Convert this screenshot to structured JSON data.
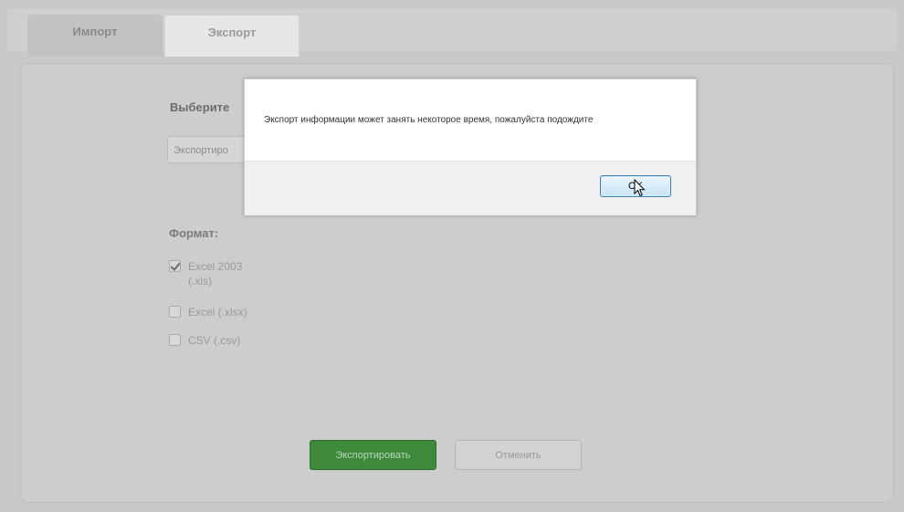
{
  "tabs": [
    {
      "label": "Импорт",
      "active": false
    },
    {
      "label": "Экспорт",
      "active": true
    }
  ],
  "form": {
    "select_label": "Выберите",
    "select_value": "Экспортиро",
    "format_label": "Формат:",
    "options": [
      {
        "label": "Excel 2003 (.xls)",
        "checked": true
      },
      {
        "label": "Excel (.xlsx)",
        "checked": false
      },
      {
        "label": "CSV (.csv)",
        "checked": false
      }
    ],
    "export_button": "Экспортировать",
    "cancel_button": "Отменить"
  },
  "dialog": {
    "message": "Экспорт информации может занять некоторое время, пожалуйста подождите",
    "ok_label": "OK"
  },
  "colors": {
    "primary_button": "#3d8a3d",
    "overlay": "#c9c9c9"
  }
}
